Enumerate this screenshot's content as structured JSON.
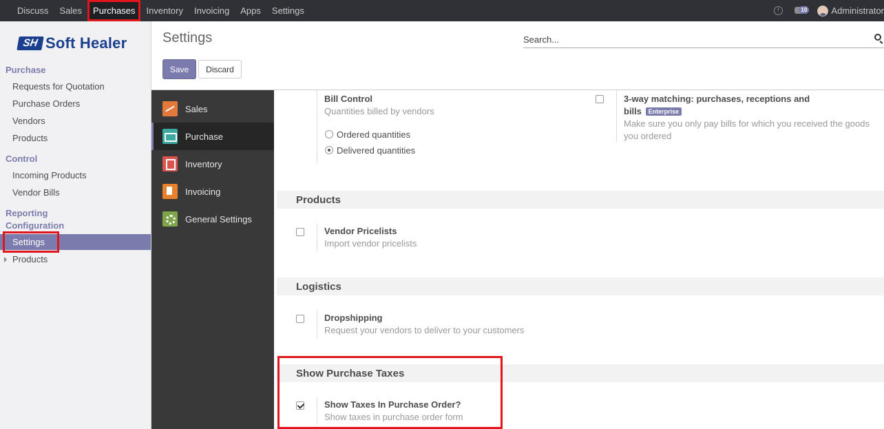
{
  "topbar": {
    "menu": [
      "Discuss",
      "Sales",
      "Purchases",
      "Inventory",
      "Invoicing",
      "Apps",
      "Settings"
    ],
    "active_menu": "Purchases",
    "chat_count": "10",
    "user_name": "Administrator"
  },
  "sidebar": {
    "logo_mark": "SH",
    "logo_text": "Soft Healer",
    "sections": {
      "purchase": "Purchase",
      "control": "Control",
      "reporting": "Reporting",
      "configuration": "Configuration"
    },
    "purchase_items": [
      "Requests for Quotation",
      "Purchase Orders",
      "Vendors",
      "Products"
    ],
    "control_items": [
      "Incoming Products",
      "Vendor Bills"
    ],
    "configuration_items": [
      "Settings",
      "Products"
    ],
    "active_item": "Settings"
  },
  "control_panel": {
    "title": "Settings",
    "search_placeholder": "Search...",
    "save_label": "Save",
    "discard_label": "Discard"
  },
  "apps_nav": [
    "Sales",
    "Purchase",
    "Inventory",
    "Invoicing",
    "General Settings"
  ],
  "apps_nav_active": "Purchase",
  "settings": {
    "bill_control": {
      "title": "Bill Control",
      "description": "Quantities billed by vendors",
      "options": [
        "Ordered quantities",
        "Delivered quantities"
      ],
      "selected": "Delivered quantities"
    },
    "three_way": {
      "title_line1": "3-way matching: purchases, receptions and",
      "title_line2": "bills",
      "badge": "Enterprise",
      "description_line1": "Make sure you only pay bills for which you received the goods",
      "description_line2": "you ordered",
      "checked": false
    },
    "products_section": {
      "header": "Products",
      "title": "Vendor Pricelists",
      "description": "Import vendor pricelists",
      "checked": false
    },
    "logistics_section": {
      "header": "Logistics",
      "title": "Dropshipping",
      "description": "Request your vendors to deliver to your customers",
      "checked": false
    },
    "taxes_section": {
      "header": "Show Purchase Taxes",
      "title": "Show Taxes In Purchase Order?",
      "description": "Show taxes in purchase order form",
      "checked": true
    }
  },
  "colors": {
    "accent": "#7c7bad",
    "topbar": "#2f3136",
    "highlight": "#e0151d",
    "apps_nav_bg": "#393939"
  }
}
